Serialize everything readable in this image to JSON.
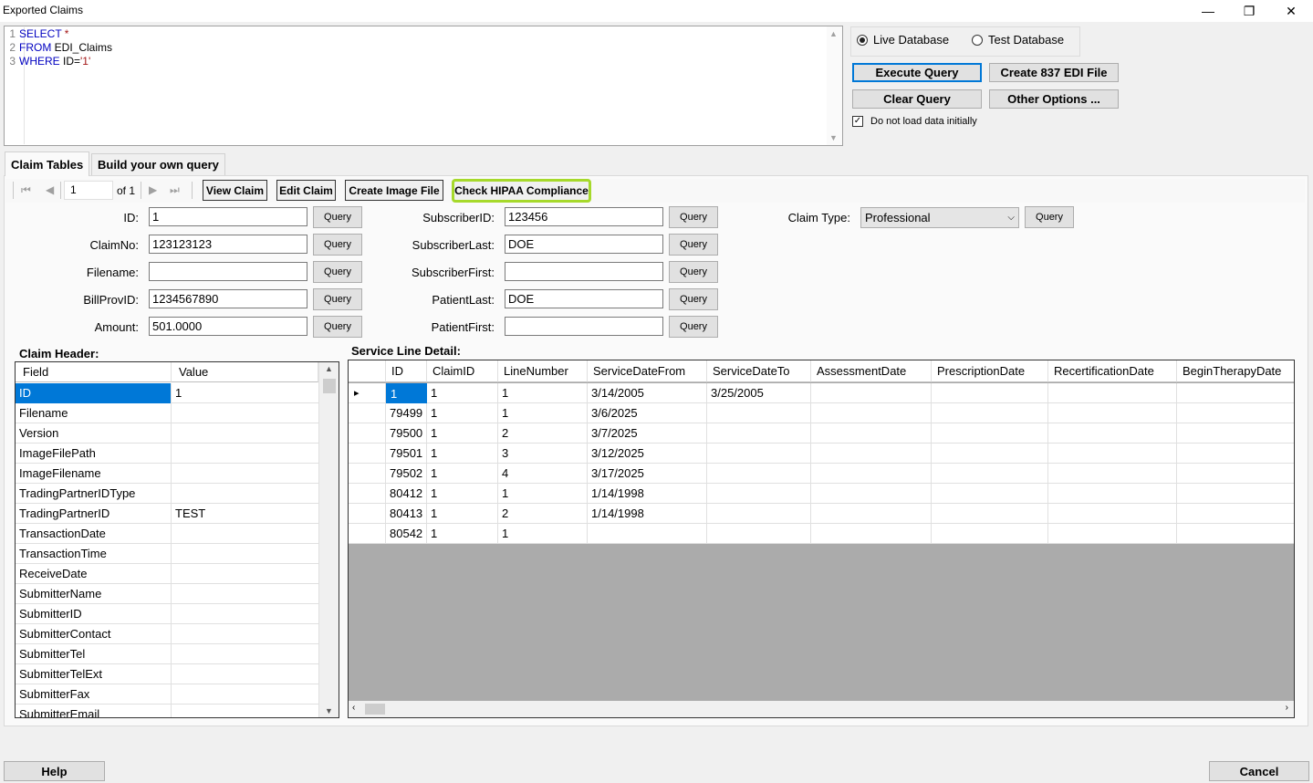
{
  "window": {
    "title": "Exported Claims",
    "minimize": "—",
    "restore": "❐",
    "close": "✕"
  },
  "sql": {
    "lines": [
      {
        "num": "1",
        "parts": [
          {
            "t": "SELECT",
            "k": "kw"
          },
          {
            "t": " *",
            "k": "str"
          }
        ]
      },
      {
        "num": "2",
        "parts": [
          {
            "t": "FROM",
            "k": "kw"
          },
          {
            "t": " EDI_Claims",
            "k": ""
          }
        ]
      },
      {
        "num": "3",
        "parts": [
          {
            "t": "WHERE",
            "k": "kw"
          },
          {
            "t": " ID=",
            "k": ""
          },
          {
            "t": "'1'",
            "k": "str"
          }
        ]
      }
    ]
  },
  "database": {
    "live_label": "Live Database",
    "test_label": "Test Database",
    "selected": "live"
  },
  "actions": {
    "execute": "Execute Query",
    "create_837": "Create 837 EDI File",
    "clear": "Clear Query",
    "other": "Other Options ...",
    "no_load_label": "Do not load data initially",
    "no_load_checked": "✓"
  },
  "tabs": {
    "claim_tables": "Claim Tables",
    "build_query": "Build your own query"
  },
  "navigator": {
    "position": "1",
    "of": "of 1"
  },
  "toolbar": {
    "view_claim": "View Claim",
    "edit_claim": "Edit Claim",
    "create_image": "Create Image File",
    "check_hipaa": "Check HIPAA Compliance"
  },
  "query_label": "Query",
  "fields_left": [
    {
      "label": "ID:",
      "value": "1"
    },
    {
      "label": "ClaimNo:",
      "value": "123123123"
    },
    {
      "label": "Filename:",
      "value": ""
    },
    {
      "label": "BillProvID:",
      "value": "1234567890"
    },
    {
      "label": "Amount:",
      "value": "501.0000"
    }
  ],
  "fields_right": [
    {
      "label": "SubscriberID:",
      "value": "123456"
    },
    {
      "label": "SubscriberLast:",
      "value": "DOE"
    },
    {
      "label": "SubscriberFirst:",
      "value": ""
    },
    {
      "label": "PatientLast:",
      "value": "DOE"
    },
    {
      "label": "PatientFirst:",
      "value": ""
    }
  ],
  "claim_type": {
    "label": "Claim Type:",
    "value": "Professional"
  },
  "claim_header": {
    "title": "Claim Header:",
    "columns": [
      "Field",
      "Value"
    ],
    "rows": [
      [
        "ID",
        "1"
      ],
      [
        "Filename",
        ""
      ],
      [
        "Version",
        ""
      ],
      [
        "ImageFilePath",
        ""
      ],
      [
        "ImageFilename",
        ""
      ],
      [
        "TradingPartnerIDType",
        ""
      ],
      [
        "TradingPartnerID",
        "TEST"
      ],
      [
        "TransactionDate",
        ""
      ],
      [
        "TransactionTime",
        ""
      ],
      [
        "ReceiveDate",
        ""
      ],
      [
        "SubmitterName",
        ""
      ],
      [
        "SubmitterID",
        ""
      ],
      [
        "SubmitterContact",
        ""
      ],
      [
        "SubmitterTel",
        ""
      ],
      [
        "SubmitterTelExt",
        ""
      ],
      [
        "SubmitterFax",
        ""
      ],
      [
        "SubmitterEmail",
        ""
      ]
    ]
  },
  "service_lines": {
    "title": "Service Line Detail:",
    "columns": [
      "ID",
      "ClaimID",
      "LineNumber",
      "ServiceDateFrom",
      "ServiceDateTo",
      "AssessmentDate",
      "PrescriptionDate",
      "RecertificationDate",
      "BeginTherapyDate"
    ],
    "rows": [
      [
        "1",
        "1",
        "1",
        "3/14/2005",
        "3/25/2005",
        "",
        "",
        "",
        ""
      ],
      [
        "79499",
        "1",
        "1",
        "3/6/2025",
        "",
        "",
        "",
        "",
        ""
      ],
      [
        "79500",
        "1",
        "2",
        "3/7/2025",
        "",
        "",
        "",
        "",
        ""
      ],
      [
        "79501",
        "1",
        "3",
        "3/12/2025",
        "",
        "",
        "",
        "",
        ""
      ],
      [
        "79502",
        "1",
        "4",
        "3/17/2025",
        "",
        "",
        "",
        "",
        ""
      ],
      [
        "80412",
        "1",
        "1",
        "1/14/1998",
        "",
        "",
        "",
        "",
        ""
      ],
      [
        "80413",
        "1",
        "2",
        "1/14/1998",
        "",
        "",
        "",
        "",
        ""
      ],
      [
        "80542",
        "1",
        "1",
        "",
        "",
        "",
        "",
        "",
        ""
      ]
    ]
  },
  "footer": {
    "help": "Help",
    "cancel": "Cancel"
  },
  "colors": {
    "accent": "#0078d7",
    "hipaa_highlight": "#a6d92b",
    "grid_empty": "#ababab"
  }
}
